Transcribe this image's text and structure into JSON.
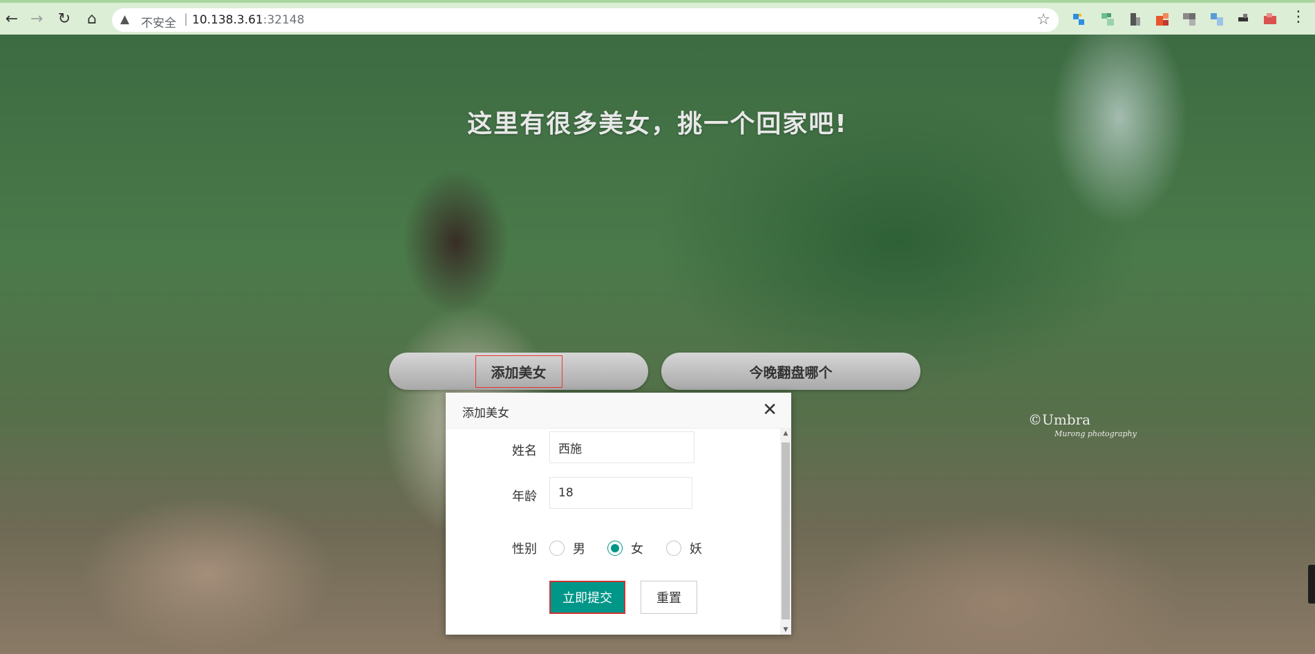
{
  "browser": {
    "security_label": "不安全",
    "separator": "|",
    "url_host": "10.138.3.61",
    "url_port": ":32148",
    "icons": {
      "back": "arrow-left-icon",
      "forward": "arrow-right-icon",
      "reload": "reload-icon",
      "home": "home-icon",
      "warning": "warning-triangle-icon",
      "bookmark": "star-icon",
      "menu": "vertical-dots-icon"
    },
    "extension_colors": [
      "#2f8de4",
      "#6cc08e",
      "#555555",
      "#e8562b",
      "#9a9a9a",
      "#5b9bd5",
      "#333333",
      "#d9534f"
    ]
  },
  "page": {
    "title": "这里有很多美女，挑一个回家吧!",
    "add_button": "添加美女",
    "pick_button": "今晚翻盘哪个",
    "watermark_main": "©Umbra",
    "watermark_sub": "Murong photography"
  },
  "dialog": {
    "title": "添加美女",
    "name_label": "姓名",
    "name_value": "西施",
    "age_label": "年龄",
    "age_value": "18",
    "gender_label": "性别",
    "gender_options": [
      "男",
      "女",
      "妖"
    ],
    "gender_selected": "女",
    "submit_label": "立即提交",
    "reset_label": "重置",
    "accent_color": "#009688"
  }
}
